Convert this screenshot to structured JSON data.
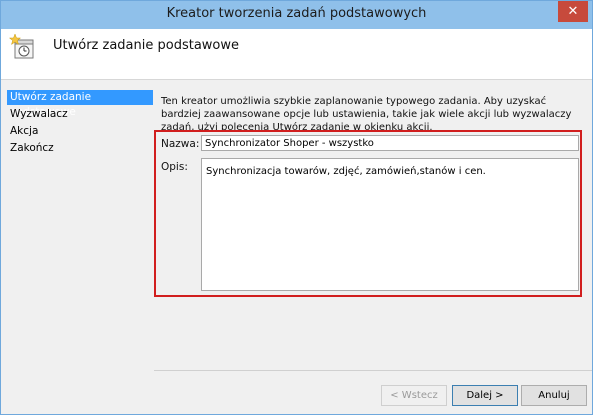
{
  "window": {
    "title": "Kreator tworzenia zadań podstawowych",
    "close_glyph": "✕"
  },
  "header": {
    "title": "Utwórz zadanie podstawowe",
    "icon": "task-clock-icon"
  },
  "sidebar": {
    "items": [
      {
        "label": "Utwórz zadanie podstawowe",
        "active": true
      },
      {
        "label": "Wyzwalacz",
        "active": false
      },
      {
        "label": "Akcja",
        "active": false
      },
      {
        "label": "Zakończ",
        "active": false
      }
    ]
  },
  "intro_text": "Ten kreator umożliwia szybkie zaplanowanie typowego zadania. Aby uzyskać bardziej zaawansowane opcje lub ustawienia, takie jak wiele akcji lub wyzwalaczy zadań, użyj polecenia Utwórz zadanie w okienku akcji.",
  "form": {
    "name_label": "Nazwa:",
    "name_value": "Synchronizator Shoper - wszystko",
    "desc_label": "Opis:",
    "desc_value": "Synchronizacja towarów, zdjęć, zamówień,stanów i cen."
  },
  "buttons": {
    "back": "< Wstecz",
    "next": "Dalej >",
    "cancel": "Anuluj"
  },
  "colors": {
    "titlebar": "#8fc0ea",
    "selection": "#3399ff",
    "highlight_border": "#d11e1e"
  }
}
